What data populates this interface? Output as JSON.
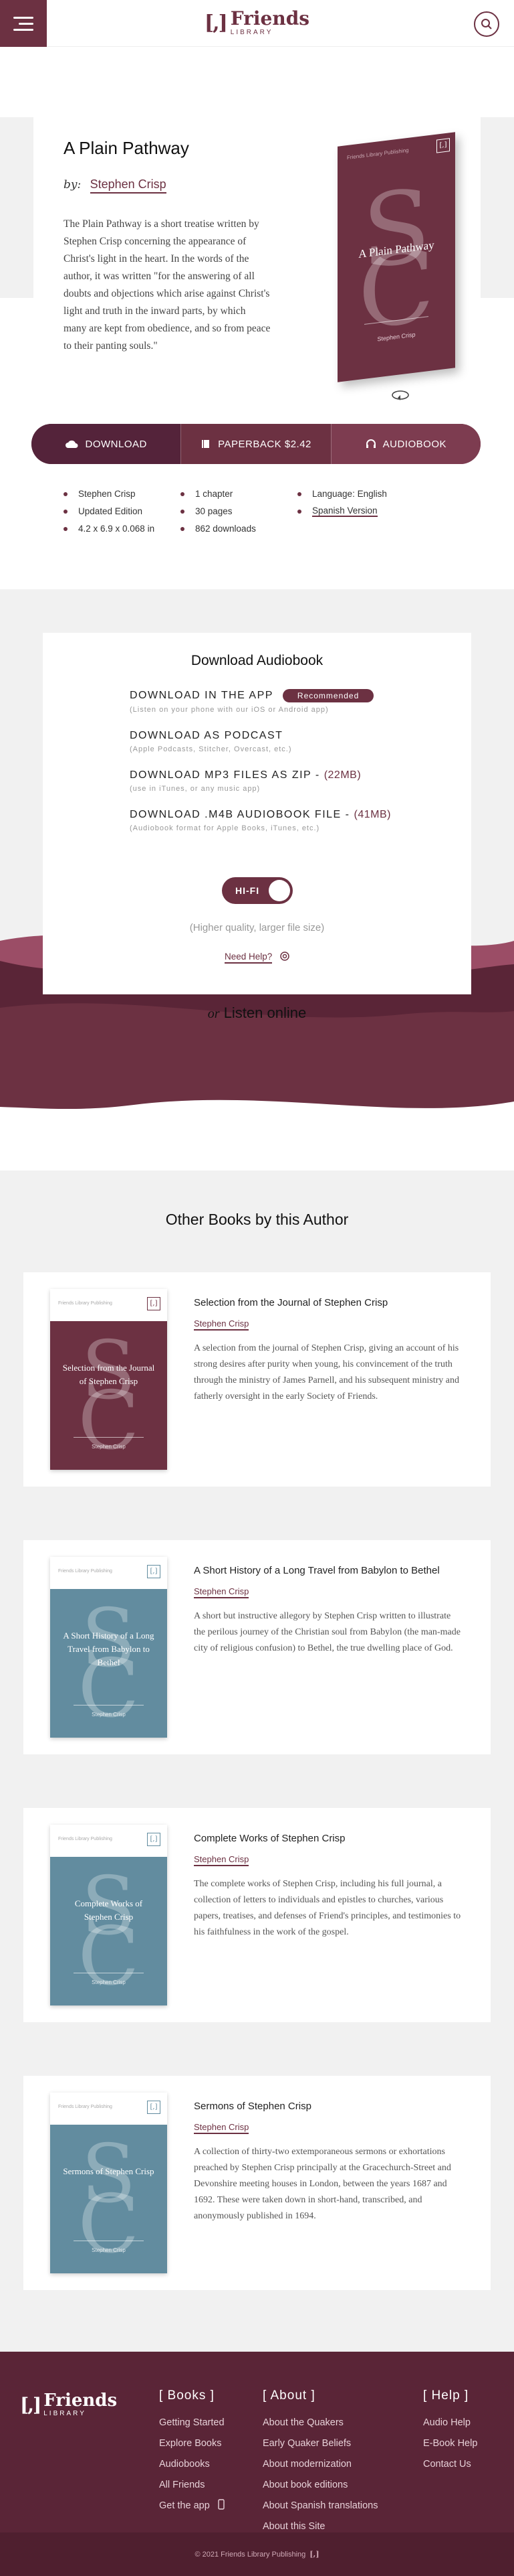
{
  "header": {
    "logo_mark": "[,]",
    "logo_name": "Friends",
    "logo_sub": "LIBRARY",
    "menu_icon": "hamburger-icon",
    "search_icon": "search-icon"
  },
  "book": {
    "title": "A Plain Pathway",
    "by_label": "by:",
    "author": "Stephen Crisp",
    "blurb": "The Plain Pathway is a short treatise written by Stephen Crisp concerning the appearance of Christ's light in the heart. In the words of the author, it was written \"for the answering of all doubts and objections which arise against Christ's light and truth in the inward parts, by which many are kept from obedience, and so from peace to their panting souls.\"",
    "cover": {
      "publisher": "Friends Library Publishing",
      "mark": "[,]",
      "monogram_s": "S",
      "monogram_c": "C",
      "title": "A Plain Pathway",
      "author": "Stephen Crisp",
      "color": "#6c3142"
    }
  },
  "actions": {
    "download": "DOWNLOAD",
    "paperback": "PAPERBACK $2.42",
    "audiobook": "AUDIOBOOK"
  },
  "meta": {
    "author": "Stephen Crisp",
    "chapters": "1 chapter",
    "language": "Language: English",
    "edition": "Updated Edition",
    "pages": "30 pages",
    "spanish": "Spanish Version",
    "dimensions": "4.2 x 6.9 x 0.068 in",
    "downloads": "862 downloads"
  },
  "audio": {
    "heading": "Download Audiobook",
    "items": [
      {
        "title": "DOWNLOAD IN THE APP",
        "badge": "Recommended",
        "sub": "(Listen on your phone with our iOS or Android app)"
      },
      {
        "title": "DOWNLOAD AS PODCAST",
        "sub": "(Apple Podcasts, Stitcher, Overcast, etc.)"
      },
      {
        "title": "DOWNLOAD MP3 FILES AS ZIP -",
        "size": "(22MB)",
        "sub": "(use in iTunes, or any music app)"
      },
      {
        "title": "DOWNLOAD .M4B AUDIOBOOK FILE -",
        "size": "(41MB)",
        "sub": "(Audiobook format for Apple Books, iTunes, etc.)"
      }
    ],
    "toggle_label": "HI-FI",
    "quality_note": "(Higher quality, larger file size)",
    "need_help": "Need Help?",
    "listen_or": "or",
    "listen_online": "Listen online"
  },
  "other": {
    "heading": "Other Books by this Author",
    "books": [
      {
        "title": "Selection from the Journal of Stephen Crisp",
        "author": "Stephen Crisp",
        "desc": "A selection from the journal of Stephen Crisp, giving an account of his strong desires after purity when young, his convincement of the truth through the ministry of James Parnell, and his subsequent ministry and fatherly oversight in the early Society of Friends.",
        "cover_title": "Selection from the Journal of Stephen Crisp",
        "cover_author": "Stephen Crisp",
        "color": "#6c3142"
      },
      {
        "title": "A Short History of a Long Travel from Babylon to Bethel",
        "author": "Stephen Crisp",
        "desc": "A short but instructive allegory by Stephen Crisp written to illustrate the perilous journey of the Christian soul from Babylon (the man-made city of religious confusion) to Bethel, the true dwelling place of God.",
        "cover_title": "A Short History of a Long Travel from Babylon to Bethel",
        "cover_author": "Stephen Crisp",
        "color": "#628c9f"
      },
      {
        "title": "Complete Works of Stephen Crisp",
        "author": "Stephen Crisp",
        "desc": "The complete works of Stephen Crisp, including his full journal, a collection of letters to individuals and epistles to churches, various papers, treatises, and defenses of Friend's principles, and testimonies to his faithfulness in the work of the gospel.",
        "cover_title": "Complete Works of Stephen Crisp",
        "cover_author": "Stephen Crisp",
        "color": "#628c9f"
      },
      {
        "title": "Sermons of Stephen Crisp",
        "author": "Stephen Crisp",
        "desc": "A collection of thirty-two extemporaneous sermons or exhortations preached by Stephen Crisp principally at the Gracechurch-Street and Devonshire meeting houses in London, between the years 1687 and 1692. These were taken down in short-hand, transcribed, and anonymously published in 1694.",
        "cover_title": "Sermons of Stephen Crisp",
        "cover_author": "Stephen Crisp",
        "color": "#628c9f"
      }
    ],
    "cover_publisher": "Friends Library Publishing"
  },
  "footer": {
    "books_heading": "[ Books ]",
    "books_links": [
      "Getting Started",
      "Explore Books",
      "Audiobooks",
      "All Friends",
      "Get the app"
    ],
    "about_heading": "[ About ]",
    "about_links": [
      "About the Quakers",
      "Early Quaker Beliefs",
      "About modernization",
      "About book editions",
      "About Spanish translations",
      "About this Site"
    ],
    "help_heading": "[ Help ]",
    "help_links": [
      "Audio Help",
      "E-Book Help",
      "Contact Us"
    ],
    "copyright": "© 2021 Friends Library Publishing"
  }
}
